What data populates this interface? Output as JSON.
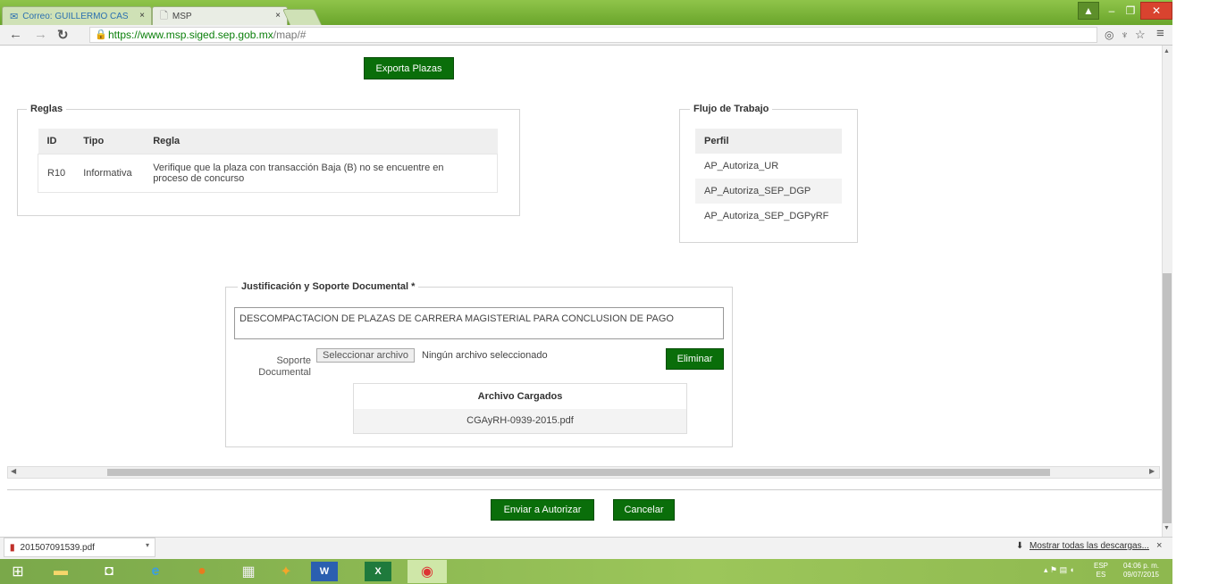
{
  "browser": {
    "tabs": [
      {
        "label": "Correo: GUILLERMO CAST",
        "active": false,
        "icon": "mail-icon"
      },
      {
        "label": "MSP",
        "active": true,
        "icon": "page-icon"
      }
    ],
    "tab_close": "×",
    "url_scheme": "https://",
    "url_host": "www.msp.siged.sep.gob.mx",
    "url_path": "/map/#"
  },
  "page": {
    "export_button": "Exporta Plazas",
    "rules": {
      "legend": "Reglas",
      "headers": [
        "ID",
        "Tipo",
        "Regla"
      ],
      "rows": [
        {
          "id": "R10",
          "type": "Informativa",
          "rule_line1": "Verifique que la plaza con transacción Baja (B) no se encuentre en",
          "rule_line2": "proceso de concurso"
        }
      ]
    },
    "workflow": {
      "legend": "Flujo de Trabajo",
      "header": "Perfil",
      "profiles": [
        "AP_Autoriza_UR",
        "AP_Autoriza_SEP_DGP",
        "AP_Autoriza_SEP_DGPyRF"
      ]
    },
    "justification": {
      "legend": "Justificación y Soporte Documental *",
      "text": "DESCOMPACTACION DE PLAZAS DE CARRERA MAGISTERIAL PARA CONCLUSION DE PAGO",
      "support_label_1": "Soporte",
      "support_label_2": "Documental",
      "file_button": "Seleccionar archivo",
      "file_status": "Ningún archivo seleccionado",
      "delete_button": "Eliminar",
      "files_header": "Archivo Cargados",
      "files": [
        "CGAyRH-0939-2015.pdf"
      ]
    },
    "send_button": "Enviar a Autorizar",
    "cancel_button": "Cancelar"
  },
  "downloads": {
    "file": "201507091539.pdf",
    "show_all": "Mostrar todas las descargas...",
    "close": "×"
  },
  "taskbar": {
    "lang_1": "ESP",
    "lang_2": "ES",
    "time": "04:06 p. m.",
    "date": "09/07/2015"
  },
  "colors": {
    "accent_green": "#0a6e0a",
    "title_bar": "#7bb33a"
  }
}
